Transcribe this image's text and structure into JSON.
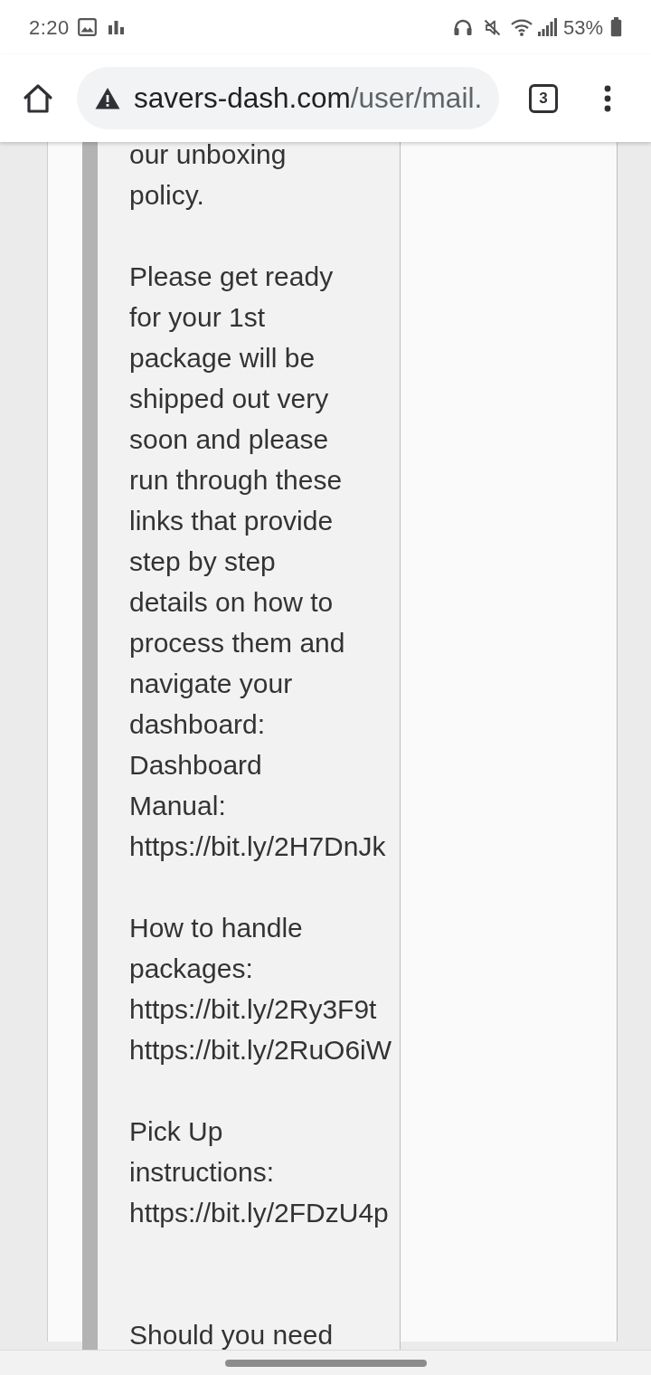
{
  "status_bar": {
    "time": "2:20",
    "battery_percent": "53%"
  },
  "browser": {
    "url": {
      "host": "savers-dash.com",
      "path": "/user/mail."
    },
    "tab_count": "3"
  },
  "message": {
    "paragraphs": [
      {
        "lines": [
          "our unboxing",
          "policy."
        ]
      },
      {
        "lines": [
          "Please get ready",
          "for your 1st",
          "package will be",
          "shipped out very",
          "soon and please",
          "run through these",
          "links that provide",
          "step by step",
          "details on how to",
          "process them and",
          "navigate your",
          "dashboard:",
          "Dashboard",
          "Manual:",
          "https://bit.ly/2H7DnJk"
        ]
      },
      {
        "lines": [
          "How to handle",
          "packages:",
          "https://bit.ly/2Ry3F9t",
          "https://bit.ly/2RuO6iW"
        ]
      },
      {
        "lines": [
          "Pick Up",
          "instructions:",
          "https://bit.ly/2FDzU4p"
        ]
      },
      {
        "lines": [
          "Should you need"
        ]
      }
    ]
  }
}
